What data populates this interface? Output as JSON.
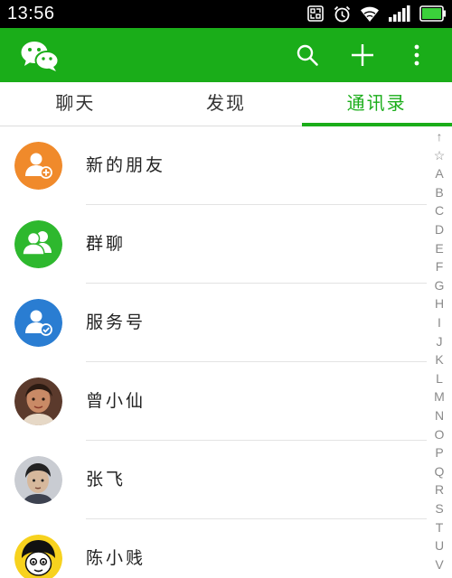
{
  "status_bar": {
    "time": "13:56",
    "icons": [
      "nfc-icon",
      "alarm-icon",
      "wifi-icon",
      "signal-icon",
      "battery-icon"
    ]
  },
  "app_bar": {
    "logo": "wechat-logo-icon",
    "actions": [
      "search-icon",
      "add-icon",
      "more-icon"
    ],
    "background_color": "#1aad19"
  },
  "tabs": [
    {
      "label": "聊天",
      "active": false
    },
    {
      "label": "发现",
      "active": false
    },
    {
      "label": "通讯录",
      "active": true
    }
  ],
  "contacts": [
    {
      "name": "新的朋友",
      "avatar": "new-friend-icon",
      "color": "#f08a2b"
    },
    {
      "name": "群聊",
      "avatar": "group-chat-icon",
      "color": "#2eb82e"
    },
    {
      "name": "服务号",
      "avatar": "official-account-icon",
      "color": "#2a7dd2"
    },
    {
      "name": "曾小仙",
      "avatar": "user-photo"
    },
    {
      "name": "张飞",
      "avatar": "user-photo"
    },
    {
      "name": "陈小贱",
      "avatar": "user-photo"
    }
  ],
  "index_letters": [
    "↑",
    "☆",
    "A",
    "B",
    "C",
    "D",
    "E",
    "F",
    "G",
    "H",
    "I",
    "J",
    "K",
    "L",
    "M",
    "N",
    "O",
    "P",
    "Q",
    "R",
    "S",
    "T",
    "U",
    "V"
  ],
  "accent_color": "#1aad19"
}
